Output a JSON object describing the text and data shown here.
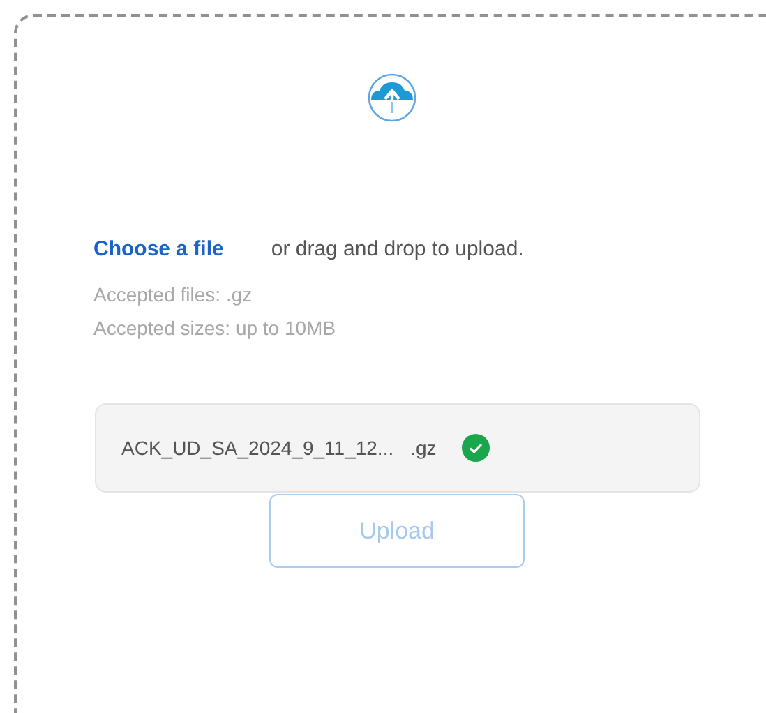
{
  "upload_panel": {
    "link": "Choose a file",
    "instruction": "or drag and drop to upload.",
    "accepted_files": "Accepted files: .gz",
    "accepted_sizes": "Accepted sizes: up to 10MB",
    "file": {
      "name": "ACK_UD_SA_2024_9_11_12...",
      "extension": ".gz",
      "verified": true
    },
    "upload_button": {
      "label": "Upload",
      "disabled": true
    }
  }
}
